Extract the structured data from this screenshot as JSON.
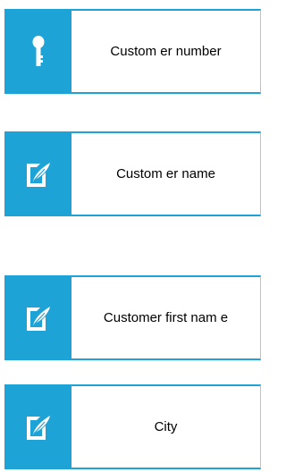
{
  "accent_color": "#1ea3d6",
  "fields": [
    {
      "icon": "key-icon",
      "label": "Custom er number"
    },
    {
      "icon": "edit-document-icon",
      "label": "Custom er name"
    },
    {
      "icon": "edit-document-icon",
      "label": "Customer first nam e"
    },
    {
      "icon": "edit-document-icon",
      "label": "City"
    }
  ]
}
